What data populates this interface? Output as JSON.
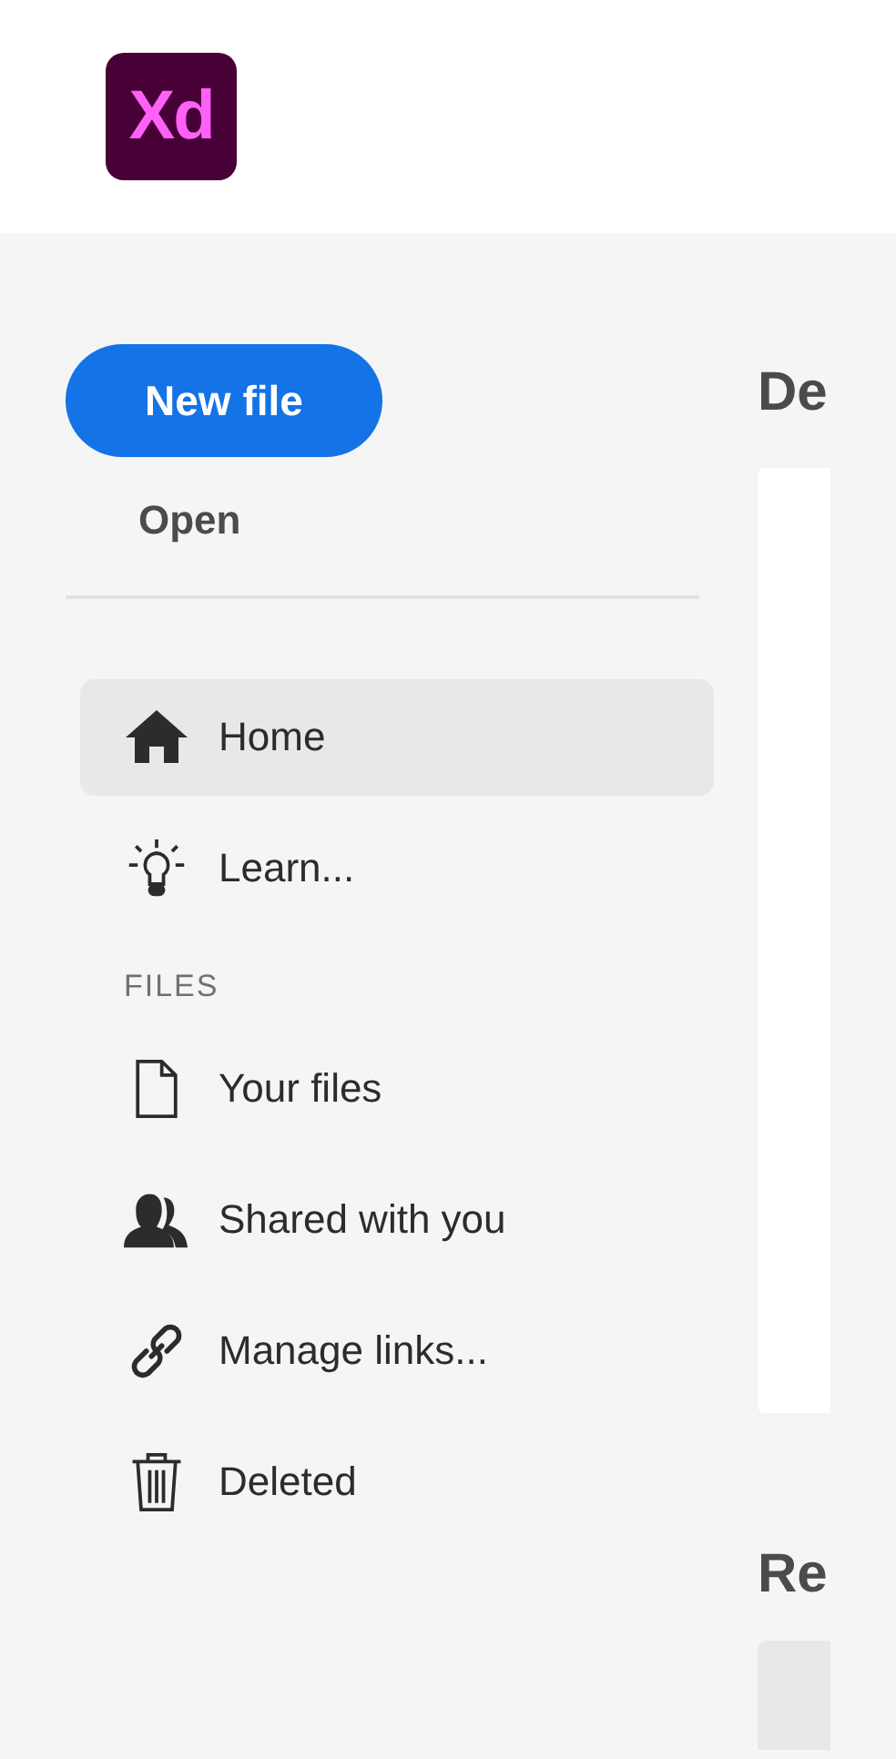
{
  "header": {
    "logo": "Xd"
  },
  "sidebar": {
    "new_file_button": "New file",
    "open_link": "Open",
    "nav": [
      {
        "label": "Home",
        "selected": true
      },
      {
        "label": "Learn...",
        "selected": false
      }
    ],
    "files_section": {
      "heading": "FILES",
      "items": [
        {
          "label": "Your files",
          "selected": false
        },
        {
          "label": "Shared with you",
          "selected": false
        },
        {
          "label": "Manage links...",
          "selected": false
        },
        {
          "label": "Deleted",
          "selected": false
        }
      ]
    }
  },
  "main": {
    "section_1": {
      "heading": "De"
    },
    "section_2": {
      "heading": "Re"
    }
  }
}
